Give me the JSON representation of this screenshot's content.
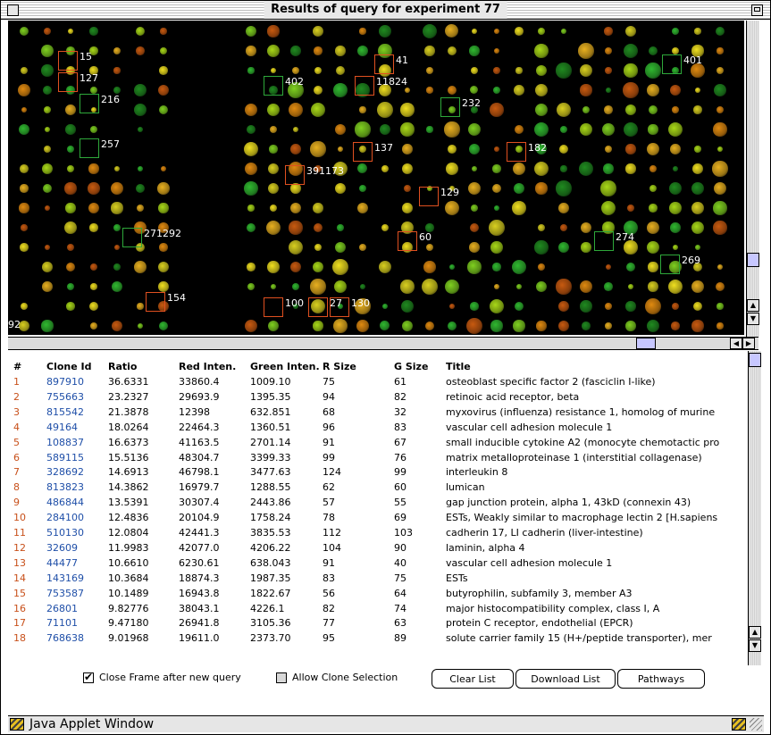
{
  "window": {
    "title": "Results of query for experiment 77"
  },
  "image_labels": [
    {
      "id": "15",
      "color": "red"
    },
    {
      "id": "127",
      "color": "red"
    },
    {
      "id": "216",
      "color": "green"
    },
    {
      "id": "257",
      "color": "green"
    },
    {
      "id": "402",
      "color": "green"
    },
    {
      "id": "41",
      "color": "red"
    },
    {
      "id": "11824",
      "color": "red"
    },
    {
      "id": "232",
      "color": "green"
    },
    {
      "id": "401",
      "color": "green"
    },
    {
      "id": "137",
      "color": "red"
    },
    {
      "id": "182",
      "color": "red"
    },
    {
      "id": "391173",
      "color": "red"
    },
    {
      "id": "129",
      "color": "red"
    },
    {
      "id": "271292",
      "color": "green"
    },
    {
      "id": "60",
      "color": "red"
    },
    {
      "id": "274",
      "color": "green"
    },
    {
      "id": "269",
      "color": "green"
    },
    {
      "id": "154",
      "color": "red"
    },
    {
      "id": "100",
      "color": "red"
    },
    {
      "id": "27",
      "color": "red"
    },
    {
      "id": "130",
      "color": "red"
    },
    {
      "id": "92",
      "color": "red"
    }
  ],
  "table": {
    "headers": [
      "#",
      "Clone Id",
      "Ratio",
      "Red Inten.",
      "Green Inten.",
      "R Size",
      "G Size",
      "Title"
    ],
    "rows": [
      [
        "1",
        "897910",
        "36.6331",
        "33860.4",
        "1009.10",
        "75",
        "61",
        "osteoblast specific factor 2 (fasciclin I-like)"
      ],
      [
        "2",
        "755663",
        "23.2327",
        "29693.9",
        "1395.35",
        "94",
        "82",
        "retinoic acid receptor, beta"
      ],
      [
        "3",
        "815542",
        "21.3878",
        "12398",
        "632.851",
        "68",
        "32",
        "myxovirus (influenza) resistance 1, homolog of murine"
      ],
      [
        "4",
        "49164",
        "18.0264",
        "22464.3",
        "1360.51",
        "96",
        "83",
        "vascular cell adhesion molecule 1"
      ],
      [
        "5",
        "108837",
        "16.6373",
        "41163.5",
        "2701.14",
        "91",
        "67",
        "small inducible cytokine A2 (monocyte chemotactic pro"
      ],
      [
        "6",
        "589115",
        "15.5136",
        "48304.7",
        "3399.33",
        "99",
        "76",
        "matrix metalloproteinase 1 (interstitial collagenase)"
      ],
      [
        "7",
        "328692",
        "14.6913",
        "46798.1",
        "3477.63",
        "124",
        "99",
        "interleukin 8"
      ],
      [
        "8",
        "813823",
        "14.3862",
        "16979.7",
        "1288.55",
        "62",
        "60",
        "lumican"
      ],
      [
        "9",
        "486844",
        "13.5391",
        "30307.4",
        "2443.86",
        "57",
        "55",
        "gap junction protein, alpha 1, 43kD (connexin 43)"
      ],
      [
        "10",
        "284100",
        "12.4836",
        "20104.9",
        "1758.24",
        "78",
        "69",
        "ESTs, Weakly similar to macrophage lectin 2 [H.sapiens"
      ],
      [
        "11",
        "510130",
        "12.0804",
        "42441.3",
        "3835.53",
        "112",
        "103",
        "cadherin 17, LI cadherin (liver-intestine)"
      ],
      [
        "12",
        "32609",
        "11.9983",
        "42077.0",
        "4206.22",
        "104",
        "90",
        "laminin, alpha 4"
      ],
      [
        "13",
        "44477",
        "10.6610",
        "6230.61",
        "638.043",
        "91",
        "40",
        "vascular cell adhesion molecule 1"
      ],
      [
        "14",
        "143169",
        "10.3684",
        "18874.3",
        "1987.35",
        "83",
        "75",
        "ESTs"
      ],
      [
        "15",
        "753587",
        "10.1489",
        "16943.8",
        "1822.67",
        "56",
        "64",
        "butyrophilin, subfamily 3, member A3"
      ],
      [
        "16",
        "26801",
        "9.82776",
        "38043.1",
        "4226.1",
        "82",
        "74",
        "major histocompatibility complex, class I, A"
      ],
      [
        "17",
        "71101",
        "9.47180",
        "26941.8",
        "3105.36",
        "77",
        "63",
        "protein C receptor, endothelial (EPCR)"
      ],
      [
        "18",
        "768638",
        "9.01968",
        "19611.0",
        "2373.70",
        "95",
        "89",
        "solute carrier family 15 (H+/peptide transporter), mer"
      ]
    ]
  },
  "controls": {
    "close_frame_label": "Close Frame after new query",
    "close_frame_checked": true,
    "allow_clone_label": "Allow Clone Selection",
    "allow_clone_checked": false,
    "clear_list": "Clear List",
    "download_list": "Download List",
    "pathways": "Pathways"
  },
  "status": {
    "text": "Java Applet Window"
  },
  "icons": [
    "close-box-icon",
    "zoom-box-icon",
    "scroll-up-arrow-icon",
    "scroll-down-arrow-icon",
    "scroll-left-arrow-icon",
    "scroll-right-arrow-icon",
    "warning-stripe-icon",
    "resize-grip-icon"
  ]
}
